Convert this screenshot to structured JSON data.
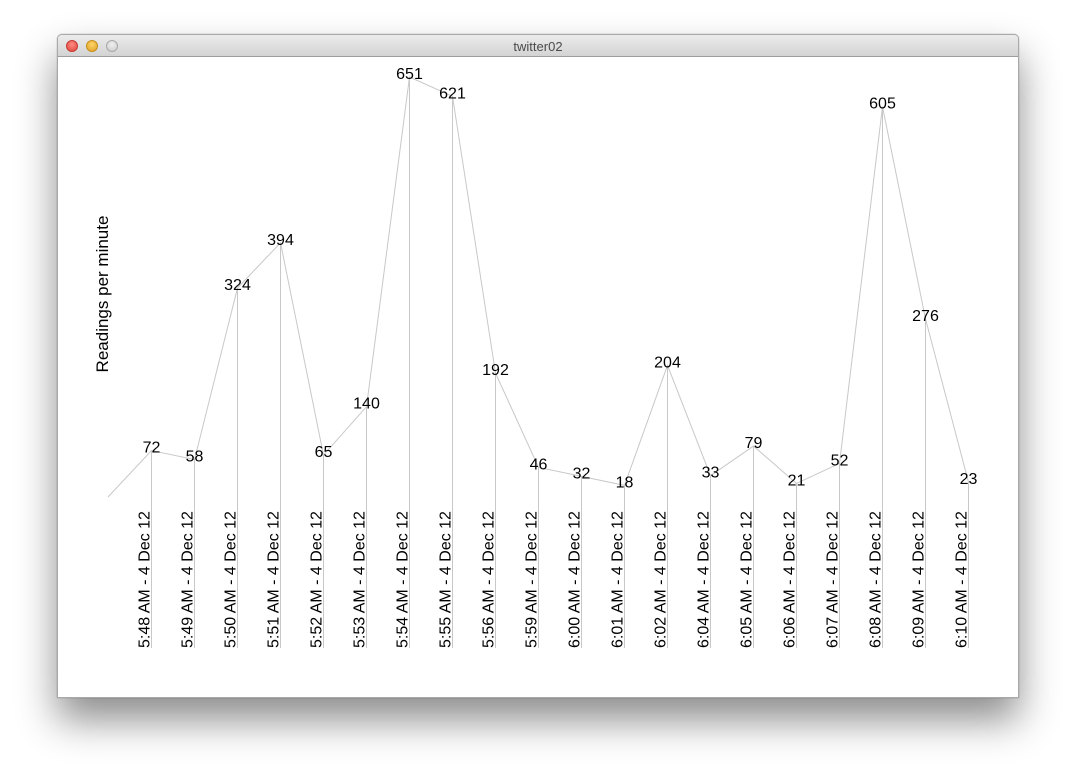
{
  "window": {
    "title": "twitter02",
    "close_icon": "close-icon",
    "minimize_icon": "minimize-icon",
    "zoom_icon": "zoom-icon"
  },
  "colors": {
    "line": "#c8c8c8",
    "text": "#000000",
    "background": "#ffffff"
  },
  "chart_data": {
    "type": "line",
    "title": "",
    "xlabel": "",
    "ylabel": "Readings per minute",
    "ylim": [
      0,
      651
    ],
    "grid": false,
    "legend": "none",
    "baseline_start": 0,
    "categories": [
      "5:48 AM - 4 Dec 12",
      "5:49 AM - 4 Dec 12",
      "5:50 AM - 4 Dec 12",
      "5:51 AM - 4 Dec 12",
      "5:52 AM - 4 Dec 12",
      "5:53 AM - 4 Dec 12",
      "5:54 AM - 4 Dec 12",
      "5:55 AM - 4 Dec 12",
      "5:56 AM - 4 Dec 12",
      "5:59 AM - 4 Dec 12",
      "6:00 AM - 4 Dec 12",
      "6:01 AM - 4 Dec 12",
      "6:02 AM - 4 Dec 12",
      "6:04 AM - 4 Dec 12",
      "6:05 AM - 4 Dec 12",
      "6:06 AM - 4 Dec 12",
      "6:07 AM - 4 Dec 12",
      "6:08 AM - 4 Dec 12",
      "6:09 AM - 4 Dec 12",
      "6:10 AM - 4 Dec 12"
    ],
    "values": [
      72,
      58,
      324,
      394,
      65,
      140,
      651,
      621,
      192,
      46,
      32,
      18,
      204,
      33,
      79,
      21,
      52,
      605,
      276,
      23
    ]
  }
}
